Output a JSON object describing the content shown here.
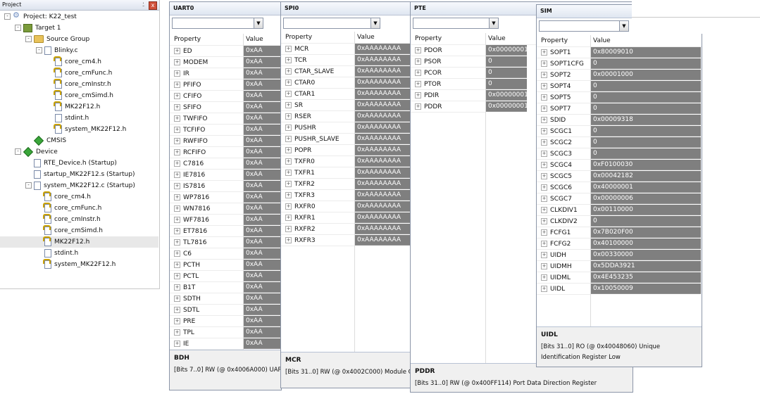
{
  "project_panel": {
    "title": "Project",
    "pin_glyph": "⍘",
    "close_glyph": "x",
    "tree": [
      {
        "label": "Project: K22_test",
        "level": 0,
        "icon": "project-icon",
        "exp": "-"
      },
      {
        "label": "Target 1",
        "level": 1,
        "icon": "target-icon",
        "exp": "-"
      },
      {
        "label": "Source Group",
        "level": 2,
        "icon": "folder-icon",
        "exp": "-"
      },
      {
        "label": "Blinky.c",
        "level": 3,
        "icon": "file-icon",
        "exp": "-"
      },
      {
        "label": "core_cm4.h",
        "level": 4,
        "icon": "header-file-icon"
      },
      {
        "label": "core_cmFunc.h",
        "level": 4,
        "icon": "header-file-icon"
      },
      {
        "label": "core_cmInstr.h",
        "level": 4,
        "icon": "header-file-icon"
      },
      {
        "label": "core_cmSimd.h",
        "level": 4,
        "icon": "header-file-icon"
      },
      {
        "label": "MK22F12.h",
        "level": 4,
        "icon": "header-file-icon"
      },
      {
        "label": "stdint.h",
        "level": 4,
        "icon": "file-icon"
      },
      {
        "label": "system_MK22F12.h",
        "level": 4,
        "icon": "header-file-icon"
      },
      {
        "label": "CMSIS",
        "level": 2,
        "icon": "diamond-icon"
      },
      {
        "label": "Device",
        "level": 1,
        "icon": "diamond-icon",
        "exp": "-"
      },
      {
        "label": "RTE_Device.h (Startup)",
        "level": 2,
        "icon": "file-icon"
      },
      {
        "label": "startup_MK22F12.s (Startup)",
        "level": 2,
        "icon": "file-icon"
      },
      {
        "label": "system_MK22F12.c (Startup)",
        "level": 2,
        "icon": "file-icon",
        "exp": "-"
      },
      {
        "label": "core_cm4.h",
        "level": 3,
        "icon": "header-file-icon"
      },
      {
        "label": "core_cmFunc.h",
        "level": 3,
        "icon": "header-file-icon"
      },
      {
        "label": "core_cmInstr.h",
        "level": 3,
        "icon": "header-file-icon"
      },
      {
        "label": "core_cmSimd.h",
        "level": 3,
        "icon": "header-file-icon"
      },
      {
        "label": "MK22F12.h",
        "level": 3,
        "icon": "header-file-icon",
        "selected": true
      },
      {
        "label": "stdint.h",
        "level": 3,
        "icon": "file-icon"
      },
      {
        "label": "system_MK22F12.h",
        "level": 3,
        "icon": "header-file-icon"
      }
    ]
  },
  "windows": [
    {
      "id": "uart0",
      "title": "UART0",
      "col_property": "Property",
      "col_value": "Value",
      "rows": [
        {
          "name": "ED",
          "value": "0xAA"
        },
        {
          "name": "MODEM",
          "value": "0xAA"
        },
        {
          "name": "IR",
          "value": "0xAA"
        },
        {
          "name": "PFIFO",
          "value": "0xAA"
        },
        {
          "name": "CFIFO",
          "value": "0xAA"
        },
        {
          "name": "SFIFO",
          "value": "0xAA"
        },
        {
          "name": "TWFIFO",
          "value": "0xAA"
        },
        {
          "name": "TCFIFO",
          "value": "0xAA"
        },
        {
          "name": "RWFIFO",
          "value": "0xAA"
        },
        {
          "name": "RCFIFO",
          "value": "0xAA"
        },
        {
          "name": "C7816",
          "value": "0xAA"
        },
        {
          "name": "IE7816",
          "value": "0xAA"
        },
        {
          "name": "IS7816",
          "value": "0xAA"
        },
        {
          "name": "WP7816",
          "value": "0xAA"
        },
        {
          "name": "WN7816",
          "value": "0xAA"
        },
        {
          "name": "WF7816",
          "value": "0xAA"
        },
        {
          "name": "ET7816",
          "value": "0xAA"
        },
        {
          "name": "TL7816",
          "value": "0xAA"
        },
        {
          "name": "C6",
          "value": "0xAA"
        },
        {
          "name": "PCTH",
          "value": "0xAA"
        },
        {
          "name": "PCTL",
          "value": "0xAA"
        },
        {
          "name": "B1T",
          "value": "0xAA"
        },
        {
          "name": "SDTH",
          "value": "0xAA"
        },
        {
          "name": "SDTL",
          "value": "0xAA"
        },
        {
          "name": "PRE",
          "value": "0xAA"
        },
        {
          "name": "TPL",
          "value": "0xAA"
        },
        {
          "name": "IE",
          "value": "0xAA"
        }
      ],
      "info_name": "BDH",
      "info_desc": "[Bits 7..0] RW (@ 0x4006A000) UAR"
    },
    {
      "id": "spi0",
      "title": "SPI0",
      "col_property": "Property",
      "col_value": "Value",
      "rows": [
        {
          "name": "MCR",
          "value": "0xAAAAAAAA"
        },
        {
          "name": "TCR",
          "value": "0xAAAAAAAA"
        },
        {
          "name": "CTAR_SLAVE",
          "value": "0xAAAAAAAA"
        },
        {
          "name": "CTAR0",
          "value": "0xAAAAAAAA"
        },
        {
          "name": "CTAR1",
          "value": "0xAAAAAAAA"
        },
        {
          "name": "SR",
          "value": "0xAAAAAAAA"
        },
        {
          "name": "RSER",
          "value": "0xAAAAAAAA"
        },
        {
          "name": "PUSHR",
          "value": "0xAAAAAAAA"
        },
        {
          "name": "PUSHR_SLAVE",
          "value": "0xAAAAAAAA"
        },
        {
          "name": "POPR",
          "value": "0xAAAAAAAA"
        },
        {
          "name": "TXFR0",
          "value": "0xAAAAAAAA"
        },
        {
          "name": "TXFR1",
          "value": "0xAAAAAAAA"
        },
        {
          "name": "TXFR2",
          "value": "0xAAAAAAAA"
        },
        {
          "name": "TXFR3",
          "value": "0xAAAAAAAA"
        },
        {
          "name": "RXFR0",
          "value": "0xAAAAAAAA"
        },
        {
          "name": "RXFR1",
          "value": "0xAAAAAAAA"
        },
        {
          "name": "RXFR2",
          "value": "0xAAAAAAAA"
        },
        {
          "name": "RXFR3",
          "value": "0xAAAAAAAA"
        }
      ],
      "info_name": "MCR",
      "info_desc": "[Bits 31..0] RW (@ 0x4002C000) Module C"
    },
    {
      "id": "pte",
      "title": "PTE",
      "col_property": "Property",
      "col_value": "Value",
      "rows": [
        {
          "name": "PDOR",
          "value": "0x00000001"
        },
        {
          "name": "PSOR",
          "value": "0"
        },
        {
          "name": "PCOR",
          "value": "0"
        },
        {
          "name": "PTOR",
          "value": "0"
        },
        {
          "name": "PDIR",
          "value": "0x00000001"
        },
        {
          "name": "PDDR",
          "value": "0x00000001"
        }
      ],
      "info_name": "PDDR",
      "info_desc": "[Bits 31..0] RW (@ 0x400FF114) Port Data Direction Register"
    },
    {
      "id": "sim",
      "title": "SIM",
      "close_glyph": "x",
      "col_property": "Property",
      "col_value": "Value",
      "rows": [
        {
          "name": "SOPT1",
          "value": "0x80009010"
        },
        {
          "name": "SOPT1CFG",
          "value": "0"
        },
        {
          "name": "SOPT2",
          "value": "0x00001000"
        },
        {
          "name": "SOPT4",
          "value": "0"
        },
        {
          "name": "SOPT5",
          "value": "0"
        },
        {
          "name": "SOPT7",
          "value": "0"
        },
        {
          "name": "SDID",
          "value": "0x00009318"
        },
        {
          "name": "SCGC1",
          "value": "0"
        },
        {
          "name": "SCGC2",
          "value": "0"
        },
        {
          "name": "SCGC3",
          "value": "0"
        },
        {
          "name": "SCGC4",
          "value": "0xF0100030"
        },
        {
          "name": "SCGC5",
          "value": "0x00042182"
        },
        {
          "name": "SCGC6",
          "value": "0x40000001"
        },
        {
          "name": "SCGC7",
          "value": "0x00000006"
        },
        {
          "name": "CLKDIV1",
          "value": "0x00110000"
        },
        {
          "name": "CLKDIV2",
          "value": "0"
        },
        {
          "name": "FCFG1",
          "value": "0x7B020F00"
        },
        {
          "name": "FCFG2",
          "value": "0x40100000"
        },
        {
          "name": "UIDH",
          "value": "0x00330000"
        },
        {
          "name": "UIDMH",
          "value": "0x5DDA3921"
        },
        {
          "name": "UIDML",
          "value": "0x4E453235"
        },
        {
          "name": "UIDL",
          "value": "0x10050009"
        }
      ],
      "info_name": "UIDL",
      "info_desc": "[Bits 31..0] RO (@ 0x40048060) Unique Identification Register Low"
    }
  ],
  "ui": {
    "expander_plus": "+",
    "expander_minus": "-",
    "dropdown_glyph": "▼"
  }
}
